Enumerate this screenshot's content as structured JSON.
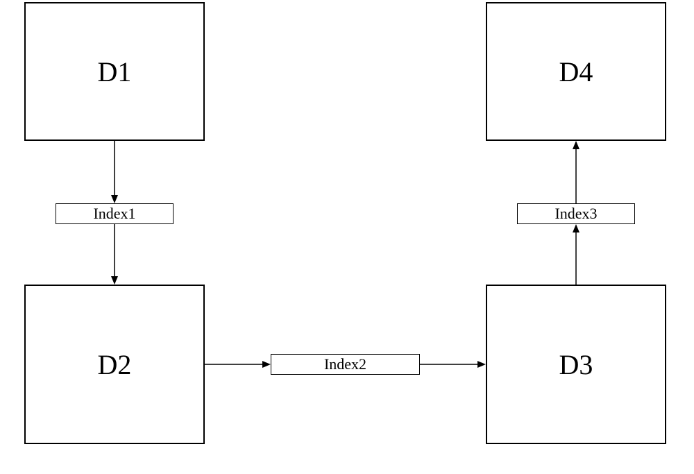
{
  "nodes": {
    "d1": "D1",
    "d2": "D2",
    "d3": "D3",
    "d4": "D4"
  },
  "indexes": {
    "index1": "Index1",
    "index2": "Index2",
    "index3": "Index3"
  }
}
